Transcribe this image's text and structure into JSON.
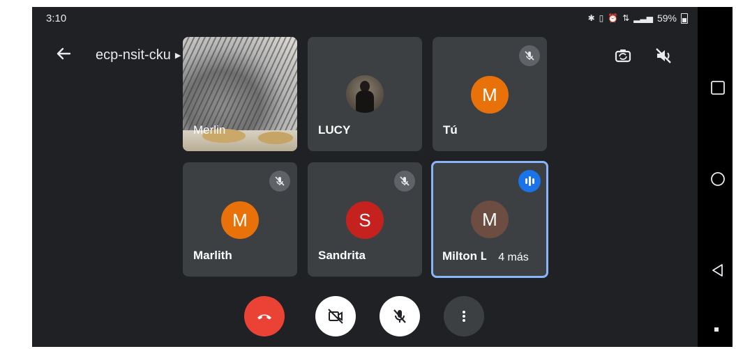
{
  "status_bar": {
    "time": "3:10",
    "battery": "59%",
    "icons": [
      "bluetooth-icon",
      "vibrate-icon",
      "alarm-icon",
      "data-icon",
      "signal-icon",
      "battery-icon"
    ]
  },
  "header": {
    "meeting_code": "ecp-nsit-cku",
    "icons": [
      "back-arrow-icon",
      "switch-camera-icon",
      "speaker-off-icon"
    ]
  },
  "participants": [
    {
      "name": "Merlin",
      "tile": "video"
    },
    {
      "name": "LUCY",
      "tile": "photo-avatar"
    },
    {
      "name": "Tú",
      "initial": "M",
      "muted": true,
      "avatar_color": "#e8710a"
    },
    {
      "name": "Marlith",
      "initial": "M",
      "muted": true,
      "avatar_color": "#e8710a"
    },
    {
      "name": "Sandrita",
      "initial": "S",
      "muted": true,
      "avatar_color": "#c5221f"
    },
    {
      "name": "Milton Le",
      "initial": "M",
      "speaking": true,
      "avatar_color": "#6d4c41"
    }
  ],
  "overflow": {
    "label": "4 más"
  },
  "controls": {
    "icons": [
      "end-call-icon",
      "camera-off-icon",
      "mic-off-icon",
      "more-vert-icon"
    ],
    "end_call_color": "#ea4335"
  },
  "android_nav": {
    "icons": [
      "recents-icon",
      "home-icon",
      "back-icon"
    ]
  },
  "colors": {
    "background": "#202124",
    "tile": "#3c4043",
    "active_border": "#8ab4f8",
    "accent": "#1a73e8"
  }
}
